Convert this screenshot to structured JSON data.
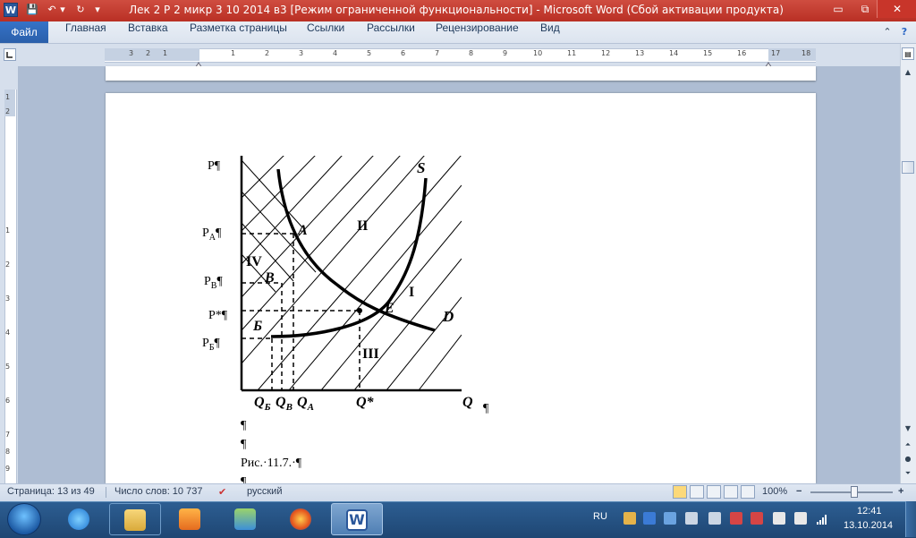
{
  "window": {
    "title": "Лек 2 Р 2 микр 3 10 2014 в3 [Режим ограниченной функциональности]  -  Microsoft Word (Сбой активации продукта)",
    "app_icon": "W",
    "min_glyph": "▭",
    "max_glyph": "⧉",
    "close_glyph": "✕"
  },
  "ribbon": {
    "tabs": [
      {
        "label": "Файл"
      },
      {
        "label": "Главная"
      },
      {
        "label": "Вставка"
      },
      {
        "label": "Разметка страницы"
      },
      {
        "label": "Ссылки"
      },
      {
        "label": "Рассылки"
      },
      {
        "label": "Рецензирование"
      },
      {
        "label": "Вид"
      }
    ]
  },
  "ruler": {
    "numbers": [
      "3",
      "2",
      "1",
      "1",
      "2",
      "3",
      "4",
      "5",
      "6",
      "7",
      "8",
      "9",
      "10",
      "11",
      "12",
      "13",
      "14",
      "15",
      "16",
      "17",
      "18"
    ],
    "vnumbers": [
      "1",
      "2",
      "1",
      "2",
      "3",
      "4",
      "5",
      "6",
      "7",
      "8",
      "9"
    ]
  },
  "figure": {
    "ylabel": "P¶",
    "pa": "P",
    "pa_sub": "A",
    "pb": "P",
    "pb_sub": "B",
    "pstar": "P*¶",
    "pbb": "P",
    "pbb_sub": "Б",
    "para": "¶",
    "curve_s": "S",
    "curve_d": "D",
    "pt_a": "A",
    "pt_b": "B",
    "pt_bb": "Б",
    "pt_e": "E",
    "area_1": "I",
    "area_2": "II",
    "area_3": "III",
    "area_4": "IV",
    "q_bb": "Q",
    "q_bb_sub": "Б",
    "q_b": "Q",
    "q_b_sub": "B",
    "q_a": "Q",
    "q_a_sub": "A",
    "q_star": "Q*",
    "q_axis": "Q"
  },
  "document": {
    "lines": [
      "¶",
      "¶",
      "Рис.·11.7.·¶",
      "¶"
    ]
  },
  "statusbar": {
    "page": "Страница: 13 из 49",
    "words": "Число слов: 10 737",
    "lang": "русский",
    "zoom": "100%",
    "minus": "−",
    "plus": "+"
  },
  "taskbar": {
    "lang": "RU",
    "time": "12:41",
    "date": "13.10.2014"
  }
}
